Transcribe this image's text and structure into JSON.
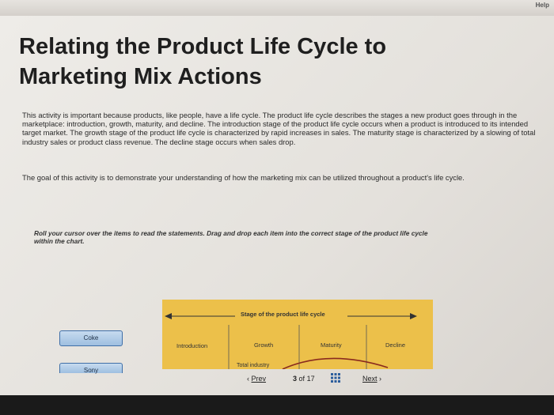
{
  "header": {
    "help": "Help"
  },
  "title": "Relating the Product Life Cycle to Marketing Mix Actions",
  "intro": "This activity is important because products, like people, have a life cycle. The product life cycle describes the stages a new product goes through in the marketplace: introduction, growth, maturity, and decline. The introduction stage of the product life cycle occurs when a product is introduced to its intended target market. The growth stage of the product life cycle is characterized by rapid increases in sales. The maturity stage is characterized by a slowing of total industry sales or product class revenue. The decline stage occurs when sales drop.",
  "goal": "The goal of this activity is to demonstrate your understanding of how the marketing mix can be utilized throughout a product's life cycle.",
  "instruction": "Roll your cursor over the items to read the statements. Drag and drop each item into the correct stage of the product life cycle within the chart.",
  "items": [
    {
      "label": "Coke"
    },
    {
      "label": "Sony"
    }
  ],
  "chart": {
    "stage_title": "Stage of the product life cycle",
    "stages": [
      "Introduction",
      "Growth",
      "Maturity",
      "Decline"
    ],
    "curve_label": "Total industry",
    "colors": {
      "background": "#ecc04a",
      "curve": "#8a2a1e"
    }
  },
  "nav": {
    "prev": "Prev",
    "page": "3",
    "of": "of",
    "total": "17",
    "next": "Next"
  }
}
